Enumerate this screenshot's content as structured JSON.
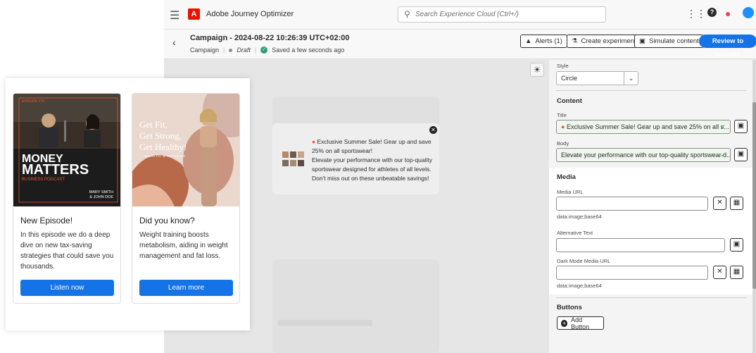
{
  "app": {
    "name": "Adobe Journey Optimizer",
    "logo_letter": "A",
    "search_placeholder": "Search Experience Cloud (Ctrl+/)"
  },
  "campaign": {
    "title": "Campaign - 2024-08-22 10:26:39 UTC+02:00",
    "type": "Campaign",
    "status": "Draft",
    "saved": "Saved a few seconds ago"
  },
  "toolbar": {
    "alerts": "Alerts (1)",
    "create_experiment": "Create experiment",
    "simulate": "Simulate content",
    "review": "Review to activate"
  },
  "preview": {
    "title": "Exclusive Summer Sale! Gear up and save 25% on all sportswear!",
    "body": "Elevate your performance with our top-quality sportswear designed for athletes of all levels. Don't miss out on these unbeatable savings!"
  },
  "panel": {
    "style_label": "Style",
    "style_value": "Circle",
    "content_heading": "Content",
    "title_label": "Title",
    "title_value": "Exclusive Summer Sale! Gear up and save 25% on all s...",
    "body_label": "Body",
    "body_value": "Elevate your performance with our top-quality sportswear d...",
    "media_heading": "Media",
    "media_url_label": "Media URL",
    "media_url_hint": "data:image;base64",
    "alt_text_label": "Alternative Text",
    "dark_media_label": "Dark Mode Media URL",
    "dark_media_hint": "data:image;base64",
    "buttons_heading": "Buttons",
    "add_button": "Add Button"
  },
  "cards": [
    {
      "episode": "EPISODE #74",
      "headline1": "MONEY",
      "headline2": "MATTERS",
      "subhead": "BUSINESS PODCAST",
      "hosts1": "MARY SMITH",
      "hosts2": "& JOHN DOE",
      "title": "New Episode!",
      "body": "In this episode we do a deep dive on new tax-saving strategies that could save you thousands.",
      "button": "Listen now"
    },
    {
      "headline1": "Get Fit,",
      "headline2": "Get Strong,",
      "headline3": "Get Healthy!",
      "tag": "HEALTH & FITNESS",
      "title": "Did you know?",
      "body": "Weight training boosts metabolism, aiding in weight management and fat loss.",
      "button": "Learn more"
    }
  ],
  "colors": {
    "accent": "#1473e6",
    "adobe_red": "#eb1000",
    "success": "#2d9d78",
    "podcast_orange": "#e8562a"
  }
}
